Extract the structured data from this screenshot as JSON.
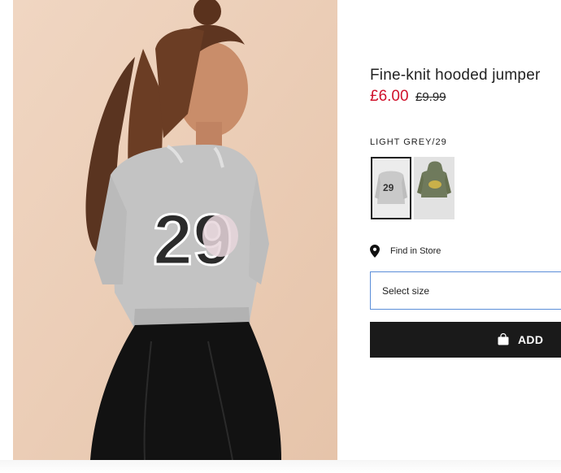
{
  "product": {
    "title": "Fine-knit hooded jumper",
    "price": "£6.00",
    "original_price": "£9.99",
    "sale_color": "#d0112b",
    "image_alt": "Girl in light grey 29 jumper and black velvet skirt"
  },
  "color": {
    "selected_label": "LIGHT GREY/29",
    "swatches": [
      {
        "name": "Light grey/29",
        "color": "#c9c9c9",
        "selected": true
      },
      {
        "name": "Khaki green",
        "color": "#6f7a5c",
        "selected": false
      }
    ]
  },
  "store": {
    "label": "Find in Store",
    "icon": "location-pin-icon"
  },
  "size": {
    "placeholder": "Select size"
  },
  "add": {
    "label": "ADD",
    "icon": "shopping-bag-icon",
    "color": "#1a1a1a"
  }
}
